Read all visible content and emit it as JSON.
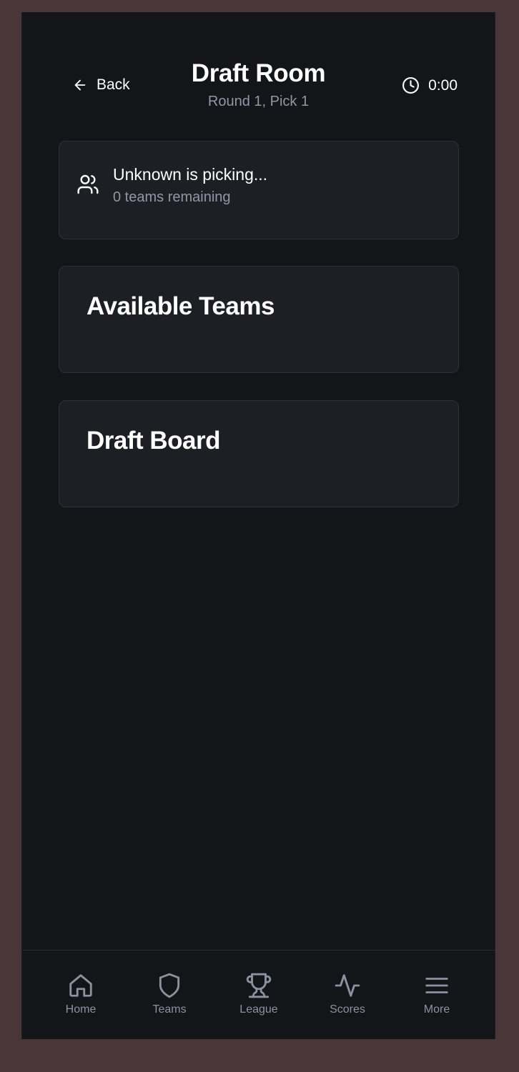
{
  "header": {
    "back_label": "Back",
    "title": "Draft Room",
    "subtitle": "Round 1, Pick 1",
    "timer": "0:00"
  },
  "status": {
    "icon": "users-icon",
    "picking_text": "Unknown is picking...",
    "remaining_text": "0 teams remaining"
  },
  "sections": {
    "available_title": "Available Teams",
    "board_title": "Draft Board"
  },
  "tabs": [
    {
      "label": "Home",
      "icon": "home-icon"
    },
    {
      "label": "Teams",
      "icon": "shield-icon"
    },
    {
      "label": "League",
      "icon": "trophy-icon"
    },
    {
      "label": "Scores",
      "icon": "activity-icon"
    },
    {
      "label": "More",
      "icon": "menu-icon"
    }
  ],
  "colors": {
    "background": "#141519",
    "card": "#1e1f24",
    "muted_text": "#9097a5",
    "tab_inactive": "#8b92a0"
  }
}
